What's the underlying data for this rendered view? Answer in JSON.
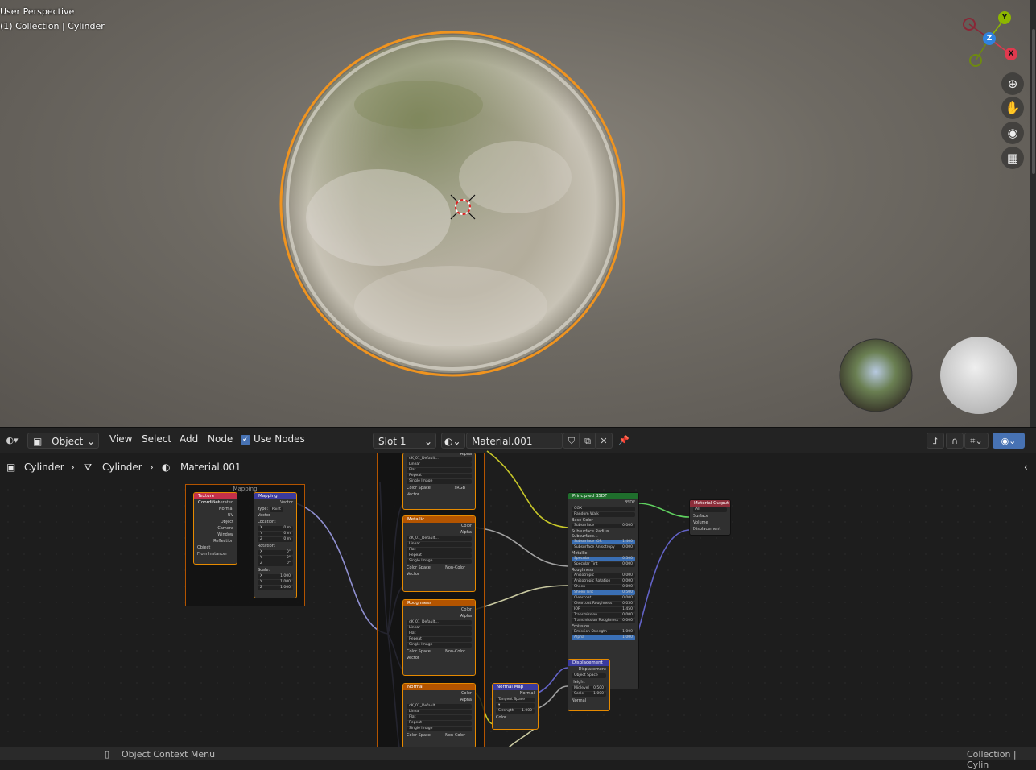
{
  "viewport": {
    "title": "User Perspective",
    "subtitle": "(1) Collection | Cylinder",
    "gizmo": {
      "x": "X",
      "y": "Y",
      "z": "Z"
    },
    "nav_icons": [
      "zoom-icon",
      "hand-icon",
      "camera-icon",
      "grid-icon"
    ]
  },
  "header": {
    "editor_mode": "Object",
    "menu": {
      "view": "View",
      "select": "Select",
      "add": "Add",
      "node": "Node"
    },
    "use_nodes_label": "Use Nodes",
    "use_nodes_checked": true,
    "slot": "Slot 1",
    "material_name": "Material.001"
  },
  "breadcrumb": {
    "object": "Cylinder",
    "mesh": "Cylinder",
    "material": "Material.001"
  },
  "nodes": {
    "frame_title": "Mapping",
    "texcoord": {
      "title": "Texture Coordinat",
      "outputs": [
        "Generated",
        "Normal",
        "UV",
        "Object",
        "Camera",
        "Window",
        "Reflection"
      ],
      "object_label": "Object",
      "from_instancer": "From Instancer"
    },
    "mapping": {
      "title": "Mapping",
      "output": "Vector",
      "type_label": "Type:",
      "type_value": "Point",
      "vector": "Vector",
      "location": "Location:",
      "loc": [
        [
          "X",
          "0 m"
        ],
        [
          "Y",
          "0 m"
        ],
        [
          "Z",
          "0 m"
        ]
      ],
      "rotation": "Rotation:",
      "rot": [
        [
          "X",
          "0°"
        ],
        [
          "Y",
          "0°"
        ],
        [
          "Z",
          "0°"
        ]
      ],
      "scale": "Scale:",
      "scl": [
        [
          "X",
          "1.000"
        ],
        [
          "Y",
          "1.000"
        ],
        [
          "Z",
          "1.000"
        ]
      ]
    },
    "top_image": {
      "alpha": "Alpha",
      "file": "dK_01_Default...",
      "interp": "Linear",
      "proj": "Flat",
      "ext": "Repeat",
      "src": "Single Image",
      "cs_label": "Color Space",
      "cs_value": "sRGB",
      "vector": "Vector"
    },
    "metallic": {
      "title": "Metallic",
      "color": "Color",
      "alpha": "Alpha",
      "file": "dK_01_Default...",
      "interp": "Linear",
      "proj": "Flat",
      "ext": "Repeat",
      "src": "Single Image",
      "cs_label": "Color Space",
      "cs_value": "Non-Color",
      "vector": "Vector"
    },
    "roughness": {
      "title": "Roughness",
      "color": "Color",
      "alpha": "Alpha",
      "file": "dK_01_Default...",
      "interp": "Linear",
      "proj": "Flat",
      "ext": "Repeat",
      "src": "Single Image",
      "cs_label": "Color Space",
      "cs_value": "Non-Color",
      "vector": "Vector"
    },
    "normal": {
      "title": "Normal",
      "color": "Color",
      "alpha": "Alpha",
      "file": "dK_01_Default...",
      "interp": "Linear",
      "proj": "Flat",
      "ext": "Repeat",
      "src": "Single Image",
      "cs_label": "Color Space",
      "cs_value": "Non-Color"
    },
    "normal_map": {
      "title": "Normal Map",
      "output": "Normal",
      "space": "Tangent Space",
      "strength_label": "Strength",
      "strength": "1.000",
      "color": "Color"
    },
    "bsdf": {
      "title": "Principled BSDF",
      "output": "BSDF",
      "dist": "GGX",
      "sss_method": "Random Walk",
      "rows": [
        [
          "Base Color",
          ""
        ],
        [
          "Subsurface",
          "0.000"
        ],
        [
          "Subsurface Radius",
          ""
        ],
        [
          "Subsurface...",
          ""
        ],
        [
          "Subsurface IOR",
          "1.400"
        ],
        [
          "Subsurface Anisotropy",
          "0.000"
        ],
        [
          "Metallic",
          ""
        ],
        [
          "Specular",
          "0.500"
        ],
        [
          "Specular Tint",
          "0.000"
        ],
        [
          "Roughness",
          ""
        ],
        [
          "Anisotropic",
          "0.000"
        ],
        [
          "Anisotropic Rotation",
          "0.000"
        ],
        [
          "Sheen",
          "0.000"
        ],
        [
          "Sheen Tint",
          "0.500"
        ],
        [
          "Clearcoat",
          "0.000"
        ],
        [
          "Clearcoat Roughness",
          "0.030"
        ],
        [
          "IOR",
          "1.450"
        ],
        [
          "Transmission",
          "0.000"
        ],
        [
          "Transmission Roughness",
          "0.000"
        ],
        [
          "Emission",
          ""
        ],
        [
          "Emission Strength",
          "1.000"
        ],
        [
          "Alpha",
          "1.000"
        ]
      ]
    },
    "displacement": {
      "title": "Displacement",
      "output": "Displacement",
      "space": "Object Space",
      "height": "Height",
      "midlevel_label": "Midlevel",
      "midlevel": "0.500",
      "scale_label": "Scale",
      "scale": "1.000",
      "normal": "Normal"
    },
    "output": {
      "title": "Material Output",
      "target": "All",
      "surface": "Surface",
      "volume": "Volume",
      "displacement": "Displacement"
    }
  },
  "status": {
    "context_menu": "Object Context Menu",
    "collection": "Collection | Cylin"
  },
  "colors": {
    "accent": "#4772b3",
    "selected": "#e68a00",
    "shader_header": "#1f6e2c",
    "texture_header": "#b35400",
    "vector_header": "#3b3b9e",
    "input_header": "#c4304a",
    "output_header": "#8c2e3a"
  }
}
